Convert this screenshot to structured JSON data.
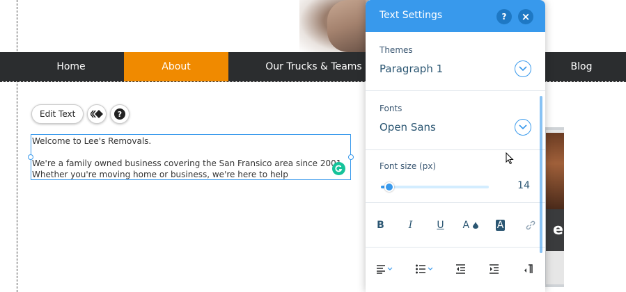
{
  "nav": {
    "items": [
      {
        "label": "Home",
        "active": false
      },
      {
        "label": "About",
        "active": true
      },
      {
        "label": "Our Trucks & Teams",
        "active": false
      },
      {
        "label": "Blog",
        "active": false
      }
    ],
    "active_color": "#f08a00",
    "bar_color": "#2b2d2f"
  },
  "toolbar": {
    "edit_text_label": "Edit Text",
    "animation_icon": "animation-icon",
    "help_icon": "help-icon"
  },
  "text_block": {
    "line1": "Welcome to Lee's Removals.",
    "line2": "We're a family owned business covering the San Fransico area since 2001.",
    "line3": "Whether you're moving home or business, we're here to help"
  },
  "side_image": {
    "caption_letter": "e"
  },
  "panel": {
    "title": "Text Settings",
    "help_label": "?",
    "close_label": "×",
    "accent": "#3899ec",
    "themes": {
      "label": "Themes",
      "value": "Paragraph 1"
    },
    "fonts": {
      "label": "Fonts",
      "value": "Open Sans"
    },
    "font_size": {
      "label": "Font size (px)",
      "value": "14",
      "fraction": 0.08
    },
    "format_buttons": [
      {
        "name": "bold-button",
        "glyph": "B",
        "icon": "bold-icon"
      },
      {
        "name": "italic-button",
        "glyph": "I",
        "icon": "italic-icon"
      },
      {
        "name": "underline-button",
        "glyph": "U",
        "icon": "underline-icon"
      },
      {
        "name": "text-color-button",
        "glyph": "A",
        "icon": "text-color-icon"
      },
      {
        "name": "highlight-button",
        "glyph": "A",
        "icon": "highlight-icon"
      },
      {
        "name": "link-button",
        "glyph": "",
        "icon": "link-icon"
      }
    ],
    "align_buttons": [
      {
        "name": "align-button",
        "icon": "align-left-icon"
      },
      {
        "name": "list-button",
        "icon": "bullet-list-icon"
      },
      {
        "name": "outdent-button",
        "icon": "outdent-icon"
      },
      {
        "name": "indent-button",
        "icon": "indent-icon"
      },
      {
        "name": "text-direction-button",
        "icon": "text-direction-icon"
      }
    ]
  }
}
